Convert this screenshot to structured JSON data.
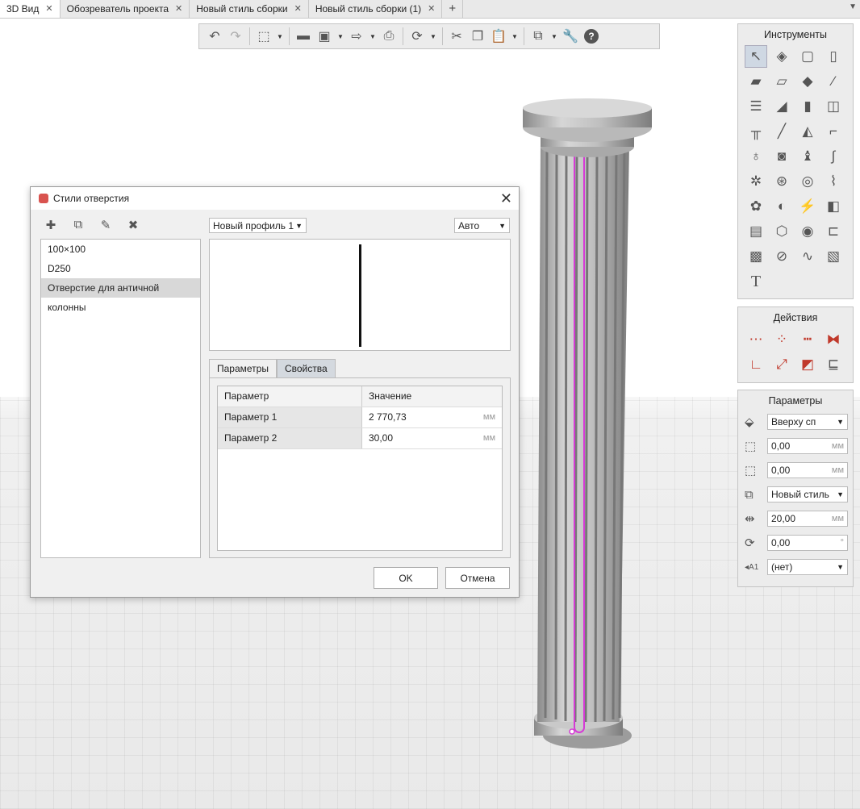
{
  "tabs": [
    {
      "label": "3D Вид"
    },
    {
      "label": "Обозреватель проекта"
    },
    {
      "label": "Новый стиль сборки"
    },
    {
      "label": "Новый стиль сборки (1)"
    }
  ],
  "toolbar": {
    "icons": [
      "undo-icon",
      "redo-icon",
      "view-3d-icon",
      "open-folder-icon",
      "save-icon",
      "export-icon",
      "print-icon",
      "sync-icon",
      "cut-icon",
      "copy-icon",
      "paste-icon",
      "layers-icon",
      "settings-wrench-icon",
      "help-icon"
    ]
  },
  "tools_panel": {
    "title": "Инструменты",
    "text_tool": "T"
  },
  "actions_panel": {
    "title": "Действия"
  },
  "params_panel": {
    "title": "Параметры",
    "align_value": "Вверху сп",
    "offset_x": "0,00",
    "offset_y": "0,00",
    "style_value": "Новый стиль",
    "width_value": "20,00",
    "rotation_value": "0,00",
    "label_value": "(нет)",
    "unit_mm": "мм",
    "unit_deg": "°"
  },
  "dialog": {
    "title": "Стили отверстия",
    "list": [
      "100×100",
      "D250",
      "Отверстие для античной колонны"
    ],
    "selected_index": 2,
    "profile_select": "Новый профиль 1",
    "mode_select": "Авто",
    "tab_params": "Параметры",
    "tab_props": "Свойства",
    "table": {
      "headers": [
        "Параметр",
        "Значение"
      ],
      "rows": [
        {
          "name": "Параметр 1",
          "value": "2 770,73",
          "unit": "мм"
        },
        {
          "name": "Параметр 2",
          "value": "30,00",
          "unit": "мм"
        }
      ]
    },
    "ok_label": "OK",
    "cancel_label": "Отмена"
  },
  "colors": {
    "highlight": "#d63ad6",
    "column": "#bdbdbd"
  }
}
